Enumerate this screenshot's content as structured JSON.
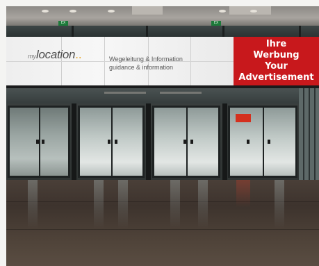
{
  "banner": {
    "logo_prefix": "my",
    "logo_main": "location",
    "logo_dots": "..",
    "wayfinding_de": "Wegeleitung & Information",
    "wayfinding_en": "guidance & information"
  },
  "advertisement": {
    "line1": "Ihre",
    "line2": "Werbung",
    "line3": "Your",
    "line4": "Advertisement",
    "color": "#c8181c"
  },
  "exit_signs": [
    "EX",
    "EX"
  ]
}
